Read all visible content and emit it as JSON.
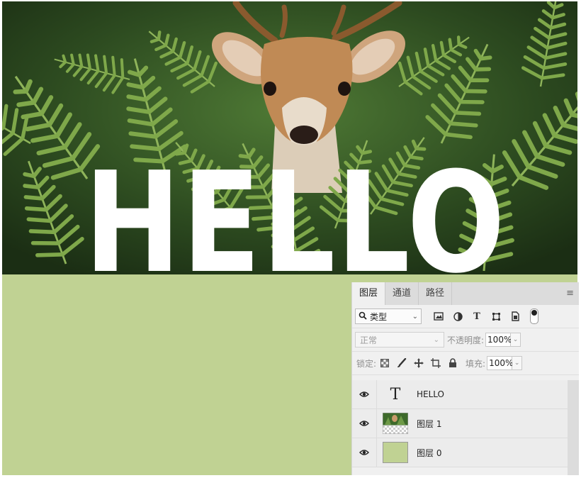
{
  "canvas": {
    "bg_color": "#c0d293",
    "text_layer_text": "HELLO",
    "photo_subject": "deer-in-ferns"
  },
  "layers_panel": {
    "tabs": [
      {
        "label": "图层",
        "active": true
      },
      {
        "label": "通道",
        "active": false
      },
      {
        "label": "路径",
        "active": false
      }
    ],
    "menu_icon": "hamburger-icon",
    "filter": {
      "search_icon": "search-icon",
      "kind_label": "类型",
      "icons": [
        "image-filter-icon",
        "adjustment-filter-icon",
        "type-filter-icon",
        "shape-filter-icon",
        "smart-object-filter-icon",
        "filter-toggle-icon"
      ]
    },
    "blend_mode": "正常",
    "opacity_label": "不透明度:",
    "opacity_value": "100%",
    "lock_label": "锁定:",
    "lock_icons": [
      "lock-transparent-pixels-icon",
      "lock-image-pixels-icon",
      "lock-position-icon",
      "lock-artboard-icon",
      "lock-all-icon"
    ],
    "fill_label": "填充:",
    "fill_value": "100%",
    "layers": [
      {
        "name": "HELLO",
        "type": "text",
        "visible": true
      },
      {
        "name": "图层 1",
        "type": "image",
        "visible": true
      },
      {
        "name": "图层 0",
        "type": "fill",
        "visible": true,
        "color": "#c0d293"
      }
    ]
  }
}
